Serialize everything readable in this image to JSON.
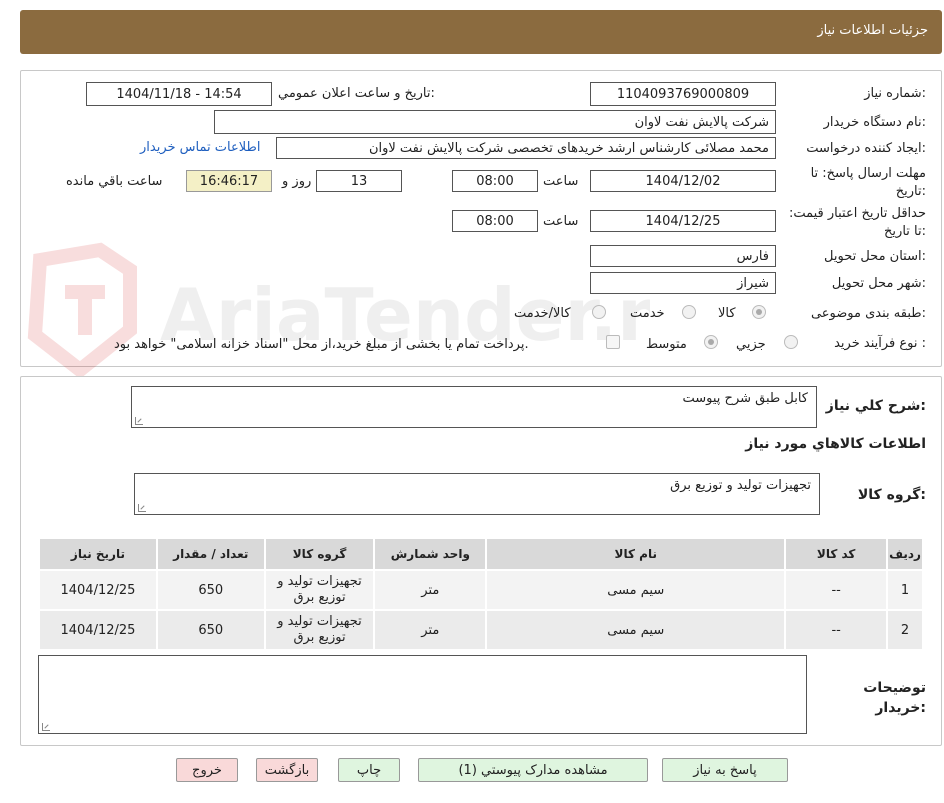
{
  "header": {
    "title": "جزئیات اطلاعات نیاز"
  },
  "watermark_text": "AriaTender.neT",
  "form": {
    "need_number_label": "شماره نیاز:",
    "need_number": "1104093769000809",
    "announce_label": "تاریخ و ساعت اعلان عمومي:",
    "announce_value": "1404/11/18 - 14:54",
    "buyer_org_label": "نام دستگاه خريدار:",
    "buyer_org": "شرکت پالایش نفت لاوان",
    "creator_label": "ايجاد کننده درخواست:",
    "creator": "محمد مصلائی کارشناس ارشد خریدهای تخصصی شرکت پالایش نفت لاوان",
    "contact_link": "اطلاعات تماس خريدار",
    "deadline_label": "مهلت ارسال پاسخ: تا تاریخ:",
    "deadline_date": "1404/12/02",
    "time_label": "ساعت",
    "deadline_time": "08:00",
    "days": "13",
    "days_label": "روز و",
    "remaining_time": "16:46:17",
    "remaining_label": "ساعت باقي مانده",
    "validity_label": "حداقل تاريخ اعتبار قيمت: تا تاریخ:",
    "validity_date": "1404/12/25",
    "validity_time": "08:00",
    "province_label": "استان محل تحويل:",
    "province": "فارس",
    "city_label": "شهر محل تحويل:",
    "city": "شیراز",
    "category_label": "طبقه بندی موضوعی:",
    "category_options": [
      "کالا",
      "خدمت",
      "کالا/خدمت"
    ],
    "process_label": "نوع فرآيند خريد :",
    "process_options": [
      "جزيي",
      "متوسط"
    ],
    "payment_note": "پرداخت تمام يا بخشی از مبلغ خريد،از محل \"اسناد خزانه اسلامی\" خواهد بود."
  },
  "details": {
    "summary_label": "شرح کلي نياز:",
    "summary_value": "کابل طبق شرح پیوست",
    "goods_info_title": "اطلاعات کالاهاي مورد نياز",
    "goods_group_label": "گروه کالا:",
    "goods_group_value": "تجهیزات تولید و توزیع برق",
    "buyer_notes_label": "توضيحات خريدار:"
  },
  "table": {
    "headers": [
      "رديف",
      "کد کالا",
      "نام کالا",
      "واحد شمارش",
      "گروه کالا",
      "تعداد / مقدار",
      "تاریخ نیاز"
    ],
    "rows": [
      [
        "1",
        "--",
        "سیم مسی",
        "متر",
        "تجهیزات تولید و توزیع برق",
        "650",
        "1404/12/25"
      ],
      [
        "2",
        "--",
        "سیم مسی",
        "متر",
        "تجهیزات تولید و توزیع برق",
        "650",
        "1404/12/25"
      ]
    ]
  },
  "buttons": {
    "reply": "پاسخ به نياز",
    "attachments": "مشاهده مدارک پیوستي (1)",
    "print": "چاپ",
    "back": "بازگشت",
    "exit": "خروج"
  }
}
